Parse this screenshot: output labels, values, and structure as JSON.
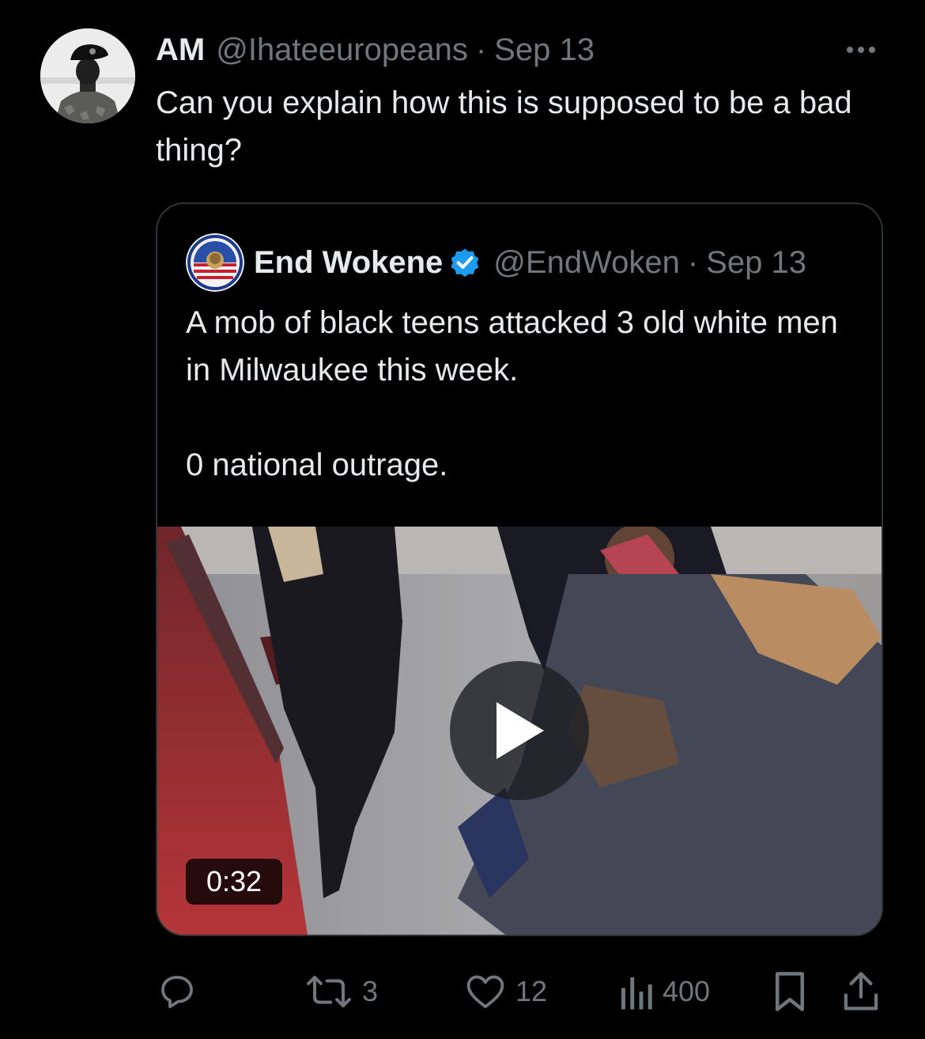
{
  "tweet": {
    "author_name": "AM",
    "author_handle": "@Ihateeuropeans",
    "separator": "·",
    "timestamp": "Sep 13",
    "text": "Can you explain how this is supposed to be a bad thing?"
  },
  "quote": {
    "author_name": "End Wokene",
    "author_handle": "@EndWoken",
    "separator": "·",
    "timestamp": "Sep 13",
    "text_line1": "A mob of black teens attacked 3 old white men in Milwaukee this week.",
    "text_line2": "0 national outrage.",
    "video": {
      "duration": "0:32"
    }
  },
  "actions": {
    "reply_count": "",
    "retweet_count": "3",
    "like_count": "12",
    "views_count": "400"
  },
  "icons": {
    "more": "ellipsis-icon",
    "verified": "verified-badge-icon",
    "play": "play-icon",
    "reply": "reply-icon",
    "retweet": "retweet-icon",
    "like": "heart-icon",
    "views": "bar-chart-icon",
    "bookmark": "bookmark-icon",
    "share": "share-icon"
  },
  "colors": {
    "background": "#000000",
    "text_primary": "#e7e9ea",
    "text_secondary": "#71767b",
    "border": "#2f3336",
    "verified_blue": "#1d9bf0"
  }
}
